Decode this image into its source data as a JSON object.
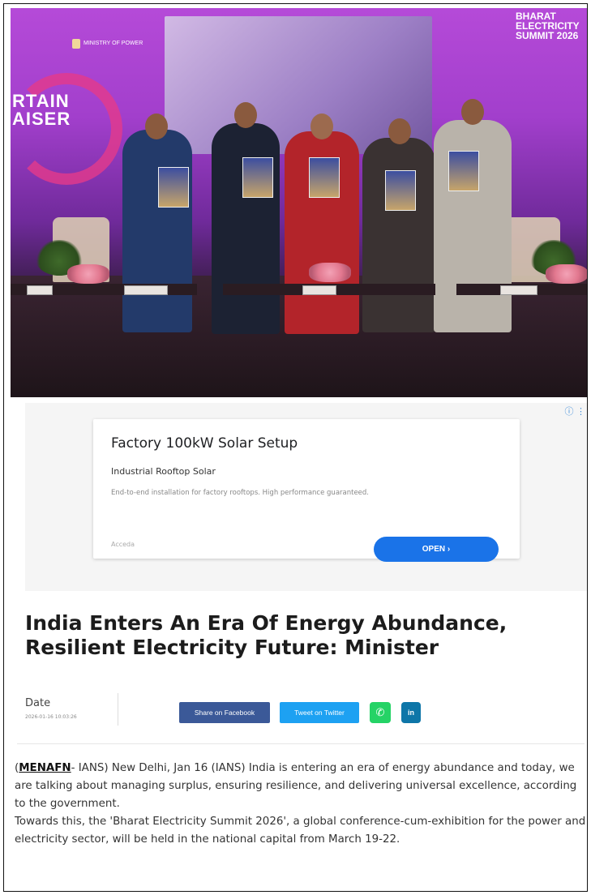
{
  "hero": {
    "summit_badge": [
      "BHARAT",
      "ELECTRICITY",
      "SUMMIT 2026"
    ],
    "banner_text": [
      "RTAIN",
      "AISER"
    ],
    "ministry_label": "MINISTRY OF POWER",
    "nameplates": [
      "",
      "",
      "",
      "",
      ""
    ]
  },
  "ad": {
    "info_icon": "info-icon",
    "title": "Factory 100kW Solar Setup",
    "subtitle": "Industrial Rooftop Solar",
    "description": "End-to-end installation for factory rooftops. High performance guaranteed.",
    "advertiser": "Acceda",
    "cta": "OPEN ›"
  },
  "article": {
    "headline": "India Enters An Era Of Energy Abundance, Resilient Electricity Future: Minister",
    "date_label": "Date",
    "date_value": "2026-01-16 10:03:26",
    "share_facebook": "Share on Facebook",
    "share_twitter": "Tweet on Twitter",
    "share_whatsapp_icon": "whatsapp-icon",
    "share_linkedin": "in",
    "source": "MENAFN",
    "para1_rest": "- IANS) New Delhi, Jan 16 (IANS) India is entering an era of energy abundance and today, we are talking about managing surplus, ensuring resilience, and delivering universal excellence, according to the government.",
    "para2": "Towards this, the 'Bharat Electricity Summit 2026', a global conference-cum-exhibition for the power and electricity sector, will be held in the national capital from March 19-22."
  },
  "colors": {
    "facebook": "#3b5998",
    "twitter": "#1da1f2",
    "whatsapp": "#25d366",
    "linkedin": "#0e76a8",
    "ad_button": "#1a73e8"
  }
}
